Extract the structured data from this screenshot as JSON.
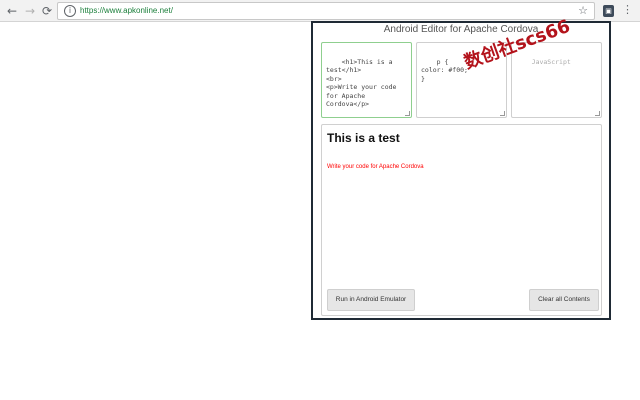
{
  "browser": {
    "url": "https://www.apkonline.net/",
    "icons": {
      "back": "arrow-left-icon",
      "forward": "arrow-right-icon",
      "reload": "reload-icon",
      "info": "info-icon",
      "star": "star-icon",
      "extension": "extension-icon",
      "menu": "kebab-menu-icon"
    }
  },
  "editor": {
    "title": "Android Editor for Apache Cordova",
    "html_code": "<h1>This is a test</h1>\n<br>\n<p>Write your code for Apache Cordova</p>",
    "css_code": "p {\ncolor: #f00;\n}",
    "js_placeholder": "JavaScript",
    "preview": {
      "heading": "This is a test",
      "paragraph": "Write your code for Apache Cordova",
      "paragraph_color": "#ff0000"
    },
    "buttons": {
      "run": "Run in Android Emulator",
      "clear": "Clear all Contents"
    }
  },
  "watermark": {
    "text": "数创社scs66"
  }
}
